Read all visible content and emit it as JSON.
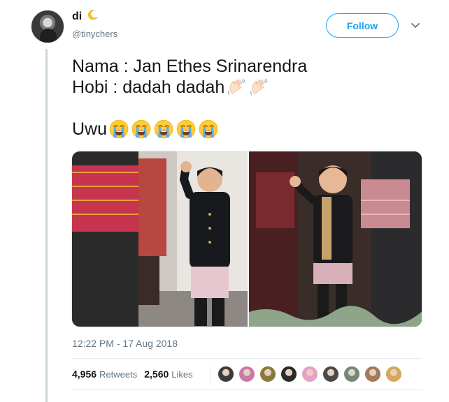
{
  "user": {
    "display_name": "di",
    "handle": "@tinychers"
  },
  "follow_label": "Follow",
  "tweet": {
    "line1": "Nama : Jan Ethes Srinarendra",
    "line2": "Hobi : dadah dadah",
    "line3": "Uwu",
    "line2_emoji": [
      "waving-hand-icon",
      "waving-hand-icon"
    ],
    "line3_emoji": [
      "loudly-crying-face-icon",
      "loudly-crying-face-icon",
      "loudly-crying-face-icon",
      "loudly-crying-face-icon",
      "loudly-crying-face-icon"
    ]
  },
  "timestamp": "12:22 PM - 17 Aug 2018",
  "stats": {
    "retweets_count": "4,956",
    "retweets_label": "Retweets",
    "likes_count": "2,560",
    "likes_label": "Likes"
  },
  "colors": {
    "accent": "#1da1f2",
    "secondary_text": "#657786",
    "thread_line": "#ccd6dd"
  },
  "likers": [
    "#3b3b3b",
    "#c97aa8",
    "#8a7a3a",
    "#2b2b2b",
    "#e89fc4",
    "#4a4a4a",
    "#6f8a78",
    "#a07a5a",
    "#d4a85a"
  ]
}
